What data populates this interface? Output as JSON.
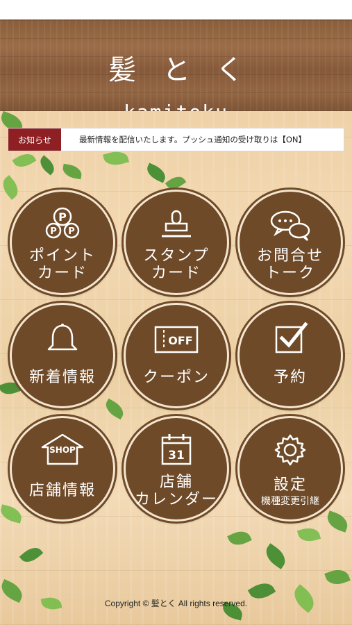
{
  "header": {
    "title": "髪とく",
    "subtitle": "kamitoku"
  },
  "news": {
    "badge": "お知らせ",
    "text": "最新情報を配信いたします。プッシュ通知の受け取りは【ON】"
  },
  "menu": [
    {
      "icon": "point-card-icon",
      "label1": "ポイント",
      "label2": "カード"
    },
    {
      "icon": "stamp-icon",
      "label1": "スタンプ",
      "label2": "カード"
    },
    {
      "icon": "chat-bubbles-icon",
      "label1": "お問合せ",
      "label2": "トーク"
    },
    {
      "icon": "bell-icon",
      "label1": "新着情報"
    },
    {
      "icon": "coupon-icon",
      "label1": "クーポン",
      "icon_text": "OFF"
    },
    {
      "icon": "checkbox-icon",
      "label1": "予約"
    },
    {
      "icon": "shop-icon",
      "label1": "店舗情報",
      "icon_text": "SHOP"
    },
    {
      "icon": "calendar-icon",
      "label1": "店舗",
      "label2": "カレンダー",
      "icon_text": "31"
    },
    {
      "icon": "gear-icon",
      "label1": "設定",
      "label2": "機種変更引継"
    }
  ],
  "footer": {
    "copyright": "Copyright © 髪とく All rights reserved."
  },
  "colors": {
    "button_brown": "#6e4a28",
    "badge_red": "#8e1f22"
  }
}
